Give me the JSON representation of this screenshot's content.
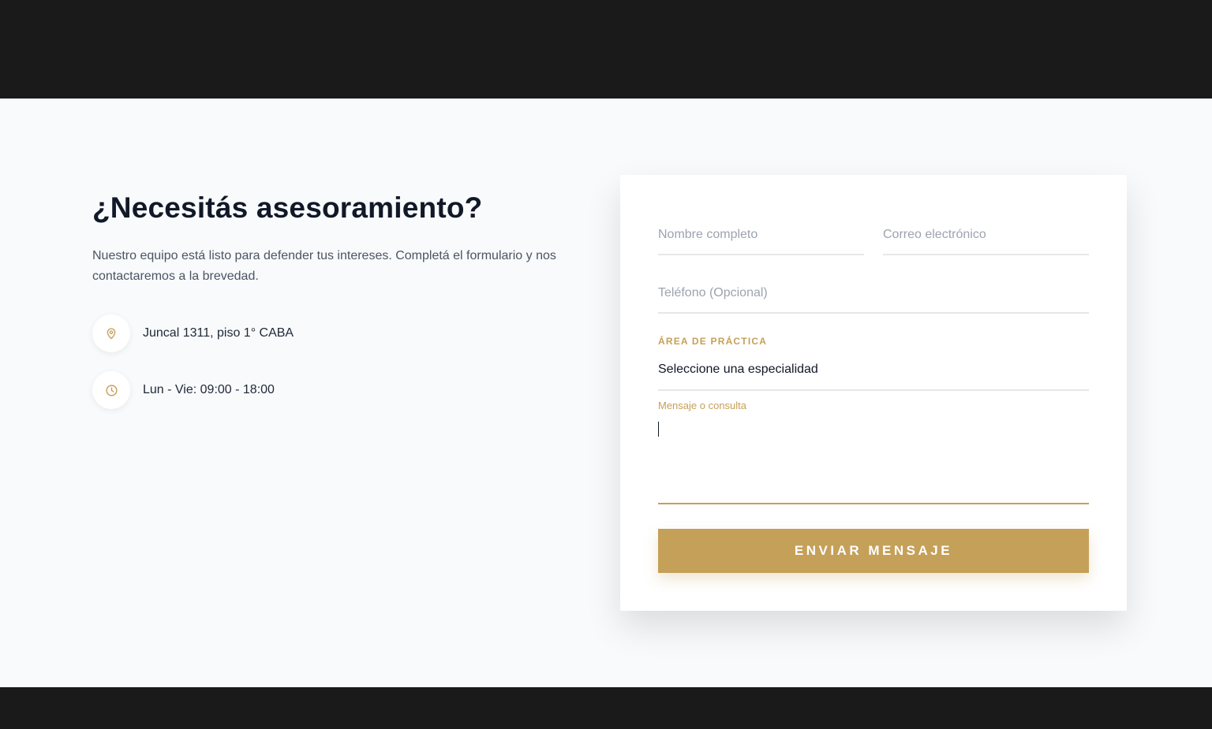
{
  "section": {
    "heading": "¿Necesitás asesoramiento?",
    "intro": "Nuestro equipo está listo para defender tus intereses. Completá el formulario y nos contactaremos a la brevedad.",
    "contacts": [
      {
        "icon": "location-pin-icon",
        "text": "Juncal 1311, piso 1° CABA"
      },
      {
        "icon": "clock-icon",
        "text": "Lun - Vie: 09:00 - 18:00"
      }
    ]
  },
  "form": {
    "name_placeholder": "Nombre completo",
    "email_placeholder": "Correo electrónico",
    "phone_placeholder": "Teléfono (Opcional)",
    "area_label": "ÁREA DE PRÁCTICA",
    "area_selected": "Seleccione una especialidad",
    "message_label": "Mensaje o consulta",
    "submit_label": "ENVIAR MENSAJE"
  },
  "colors": {
    "accent": "#c5a059",
    "dark_bar": "#1a1a1a",
    "background": "#f8fafc"
  }
}
